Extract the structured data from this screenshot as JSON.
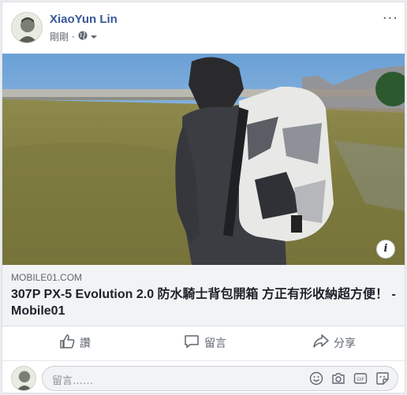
{
  "post": {
    "author": "XiaoYun Lin",
    "time": "剛剛",
    "separator": "·",
    "more_label": "···"
  },
  "link": {
    "domain": "MOBILE01.COM",
    "title": "307P PX-5 Evolution 2.0 防水騎士背包開箱 方正有形收納超方便！ - Mobile01",
    "info_label": "i"
  },
  "actions": {
    "like": "讚",
    "comment": "留言",
    "share": "分享"
  },
  "comment_box": {
    "placeholder": "留言……"
  },
  "icons": [
    "globe-icon",
    "chevron-down-icon",
    "more-icon",
    "info-icon",
    "like-icon",
    "comment-icon",
    "share-icon",
    "emoji-icon",
    "camera-icon",
    "gif-icon",
    "sticker-icon"
  ],
  "colors": {
    "author": "#385898",
    "background": "#e9ebee"
  }
}
